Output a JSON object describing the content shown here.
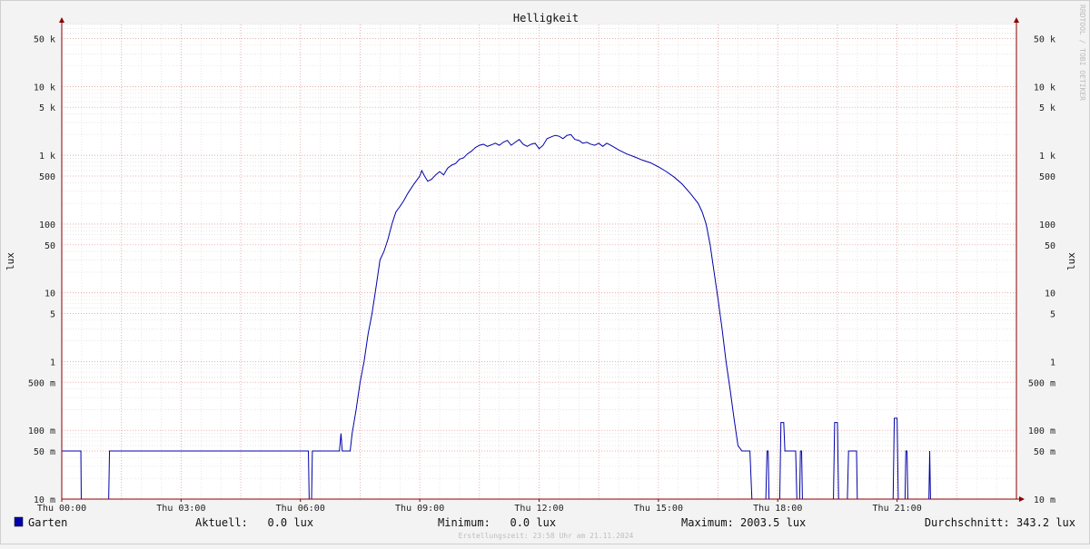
{
  "chart_data": {
    "type": "line",
    "title": "Helligkeit",
    "ylabel": "lux",
    "yscale": "log",
    "ylim": [
      0.01,
      80000
    ],
    "y_ticks": [
      {
        "v": 0.01,
        "label": "10 m"
      },
      {
        "v": 0.05,
        "label": "50 m"
      },
      {
        "v": 0.1,
        "label": "100 m"
      },
      {
        "v": 0.5,
        "label": "500 m"
      },
      {
        "v": 1,
        "label": "1"
      },
      {
        "v": 5,
        "label": "5"
      },
      {
        "v": 10,
        "label": "10"
      },
      {
        "v": 50,
        "label": "50"
      },
      {
        "v": 100,
        "label": "100"
      },
      {
        "v": 500,
        "label": "500"
      },
      {
        "v": 1000,
        "label": "1 k"
      },
      {
        "v": 5000,
        "label": "5 k"
      },
      {
        "v": 10000,
        "label": "10 k"
      },
      {
        "v": 50000,
        "label": "50 k"
      }
    ],
    "xlim": [
      0,
      24
    ],
    "x_ticks": [
      {
        "v": 0,
        "label": "Thu 00:00"
      },
      {
        "v": 3,
        "label": "Thu 03:00"
      },
      {
        "v": 6,
        "label": "Thu 06:00"
      },
      {
        "v": 9,
        "label": "Thu 09:00"
      },
      {
        "v": 12,
        "label": "Thu 12:00"
      },
      {
        "v": 15,
        "label": "Thu 15:00"
      },
      {
        "v": 18,
        "label": "Thu 18:00"
      },
      {
        "v": 21,
        "label": "Thu 21:00"
      }
    ],
    "grid": true,
    "series": [
      {
        "name": "Garten",
        "color": "#0000aa",
        "points": [
          [
            0.0,
            0.05
          ],
          [
            0.48,
            0.05
          ],
          [
            0.49,
            0.01
          ],
          [
            1.18,
            0.01
          ],
          [
            1.2,
            0.05
          ],
          [
            6.2,
            0.05
          ],
          [
            6.22,
            0.01
          ],
          [
            6.28,
            0.01
          ],
          [
            6.3,
            0.05
          ],
          [
            6.98,
            0.05
          ],
          [
            7.02,
            0.09
          ],
          [
            7.05,
            0.05
          ],
          [
            7.25,
            0.05
          ],
          [
            7.3,
            0.09
          ],
          [
            7.4,
            0.2
          ],
          [
            7.5,
            0.5
          ],
          [
            7.6,
            1.0
          ],
          [
            7.7,
            2.5
          ],
          [
            7.8,
            5
          ],
          [
            7.9,
            12
          ],
          [
            8.0,
            30
          ],
          [
            8.1,
            40
          ],
          [
            8.2,
            60
          ],
          [
            8.3,
            100
          ],
          [
            8.4,
            150
          ],
          [
            8.5,
            180
          ],
          [
            8.6,
            220
          ],
          [
            8.7,
            280
          ],
          [
            8.85,
            380
          ],
          [
            9.0,
            500
          ],
          [
            9.05,
            600
          ],
          [
            9.12,
            500
          ],
          [
            9.2,
            420
          ],
          [
            9.3,
            450
          ],
          [
            9.4,
            520
          ],
          [
            9.5,
            580
          ],
          [
            9.6,
            520
          ],
          [
            9.7,
            650
          ],
          [
            9.8,
            720
          ],
          [
            9.9,
            760
          ],
          [
            10.0,
            880
          ],
          [
            10.1,
            920
          ],
          [
            10.2,
            1050
          ],
          [
            10.3,
            1150
          ],
          [
            10.4,
            1300
          ],
          [
            10.5,
            1400
          ],
          [
            10.6,
            1450
          ],
          [
            10.7,
            1350
          ],
          [
            10.8,
            1420
          ],
          [
            10.9,
            1500
          ],
          [
            11.0,
            1400
          ],
          [
            11.1,
            1550
          ],
          [
            11.2,
            1650
          ],
          [
            11.3,
            1400
          ],
          [
            11.4,
            1550
          ],
          [
            11.5,
            1700
          ],
          [
            11.6,
            1450
          ],
          [
            11.7,
            1350
          ],
          [
            11.8,
            1450
          ],
          [
            11.9,
            1500
          ],
          [
            12.0,
            1250
          ],
          [
            12.1,
            1400
          ],
          [
            12.2,
            1750
          ],
          [
            12.3,
            1850
          ],
          [
            12.4,
            1950
          ],
          [
            12.5,
            1900
          ],
          [
            12.6,
            1750
          ],
          [
            12.7,
            1950
          ],
          [
            12.8,
            2003.5
          ],
          [
            12.9,
            1700
          ],
          [
            13.0,
            1650
          ],
          [
            13.1,
            1500
          ],
          [
            13.2,
            1550
          ],
          [
            13.3,
            1450
          ],
          [
            13.4,
            1400
          ],
          [
            13.5,
            1500
          ],
          [
            13.6,
            1350
          ],
          [
            13.7,
            1500
          ],
          [
            13.8,
            1400
          ],
          [
            13.9,
            1300
          ],
          [
            14.0,
            1200
          ],
          [
            14.2,
            1050
          ],
          [
            14.4,
            950
          ],
          [
            14.6,
            850
          ],
          [
            14.8,
            780
          ],
          [
            15.0,
            680
          ],
          [
            15.2,
            580
          ],
          [
            15.4,
            480
          ],
          [
            15.6,
            380
          ],
          [
            15.8,
            280
          ],
          [
            16.0,
            200
          ],
          [
            16.1,
            150
          ],
          [
            16.2,
            100
          ],
          [
            16.3,
            50
          ],
          [
            16.4,
            20
          ],
          [
            16.5,
            8
          ],
          [
            16.6,
            3
          ],
          [
            16.7,
            1.0
          ],
          [
            16.8,
            0.4
          ],
          [
            16.9,
            0.15
          ],
          [
            17.0,
            0.06
          ],
          [
            17.1,
            0.05
          ],
          [
            17.3,
            0.05
          ],
          [
            17.35,
            0.01
          ],
          [
            17.7,
            0.01
          ],
          [
            17.73,
            0.05
          ],
          [
            17.76,
            0.05
          ],
          [
            17.78,
            0.01
          ],
          [
            18.05,
            0.01
          ],
          [
            18.08,
            0.13
          ],
          [
            18.15,
            0.13
          ],
          [
            18.18,
            0.05
          ],
          [
            18.45,
            0.05
          ],
          [
            18.48,
            0.01
          ],
          [
            18.55,
            0.01
          ],
          [
            18.57,
            0.05
          ],
          [
            18.6,
            0.05
          ],
          [
            18.62,
            0.01
          ],
          [
            19.4,
            0.01
          ],
          [
            19.43,
            0.13
          ],
          [
            19.5,
            0.13
          ],
          [
            19.53,
            0.01
          ],
          [
            19.75,
            0.01
          ],
          [
            19.78,
            0.05
          ],
          [
            19.98,
            0.05
          ],
          [
            20.0,
            0.01
          ],
          [
            20.9,
            0.01
          ],
          [
            20.93,
            0.15
          ],
          [
            21.0,
            0.15
          ],
          [
            21.03,
            0.01
          ],
          [
            21.2,
            0.01
          ],
          [
            21.22,
            0.05
          ],
          [
            21.25,
            0.05
          ],
          [
            21.27,
            0.01
          ],
          [
            21.8,
            0.01
          ],
          [
            21.82,
            0.05
          ],
          [
            21.84,
            0.01
          ],
          [
            24.0,
            0.01
          ]
        ]
      }
    ]
  },
  "legend": {
    "series_label": "Garten",
    "swatch_color": "#0000aa",
    "current_text": "Aktuell:   0.0 lux",
    "minimum_text": "Minimum:   0.0 lux",
    "maximum_text": "Maximum: 2003.5 lux",
    "average_text": "Durchschnitt: 343.2 lux"
  },
  "footer": {
    "created_text": "Erstellungszeit: 23:58 Uhr am 21.11.2024"
  },
  "watermark": "RRDTOOL / TOBI OETIKER",
  "colors": {
    "line": "#0000aa",
    "major_grid": "#e8a0a0",
    "minor_grid": "#d8d8d8",
    "axis": "#8b0000",
    "background": "#f3f3f3"
  }
}
